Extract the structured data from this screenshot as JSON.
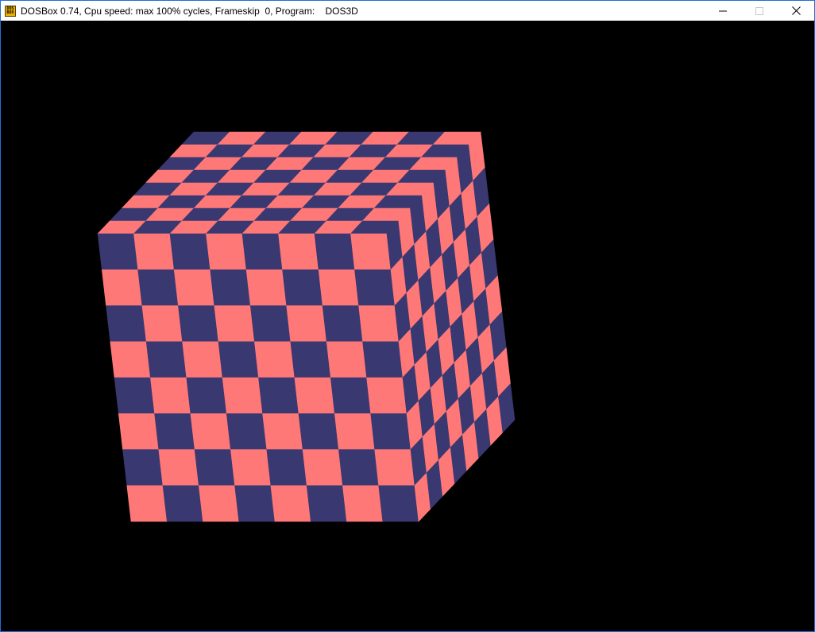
{
  "window": {
    "title": "DOSBox 0.74, Cpu speed: max 100% cycles, Frameskip  0, Program:    DOS3D",
    "icon": "dosbox-icon",
    "icon_text_top": "DOS",
    "icon_text_bottom": "BOX",
    "controls": [
      "minimize-icon",
      "maximize-icon",
      "close-icon"
    ]
  },
  "scene": {
    "object": "cube",
    "checker_grid": 8,
    "colors": {
      "tile_a": "#ff7878",
      "tile_b": "#3a3870",
      "background": "#000000"
    }
  }
}
